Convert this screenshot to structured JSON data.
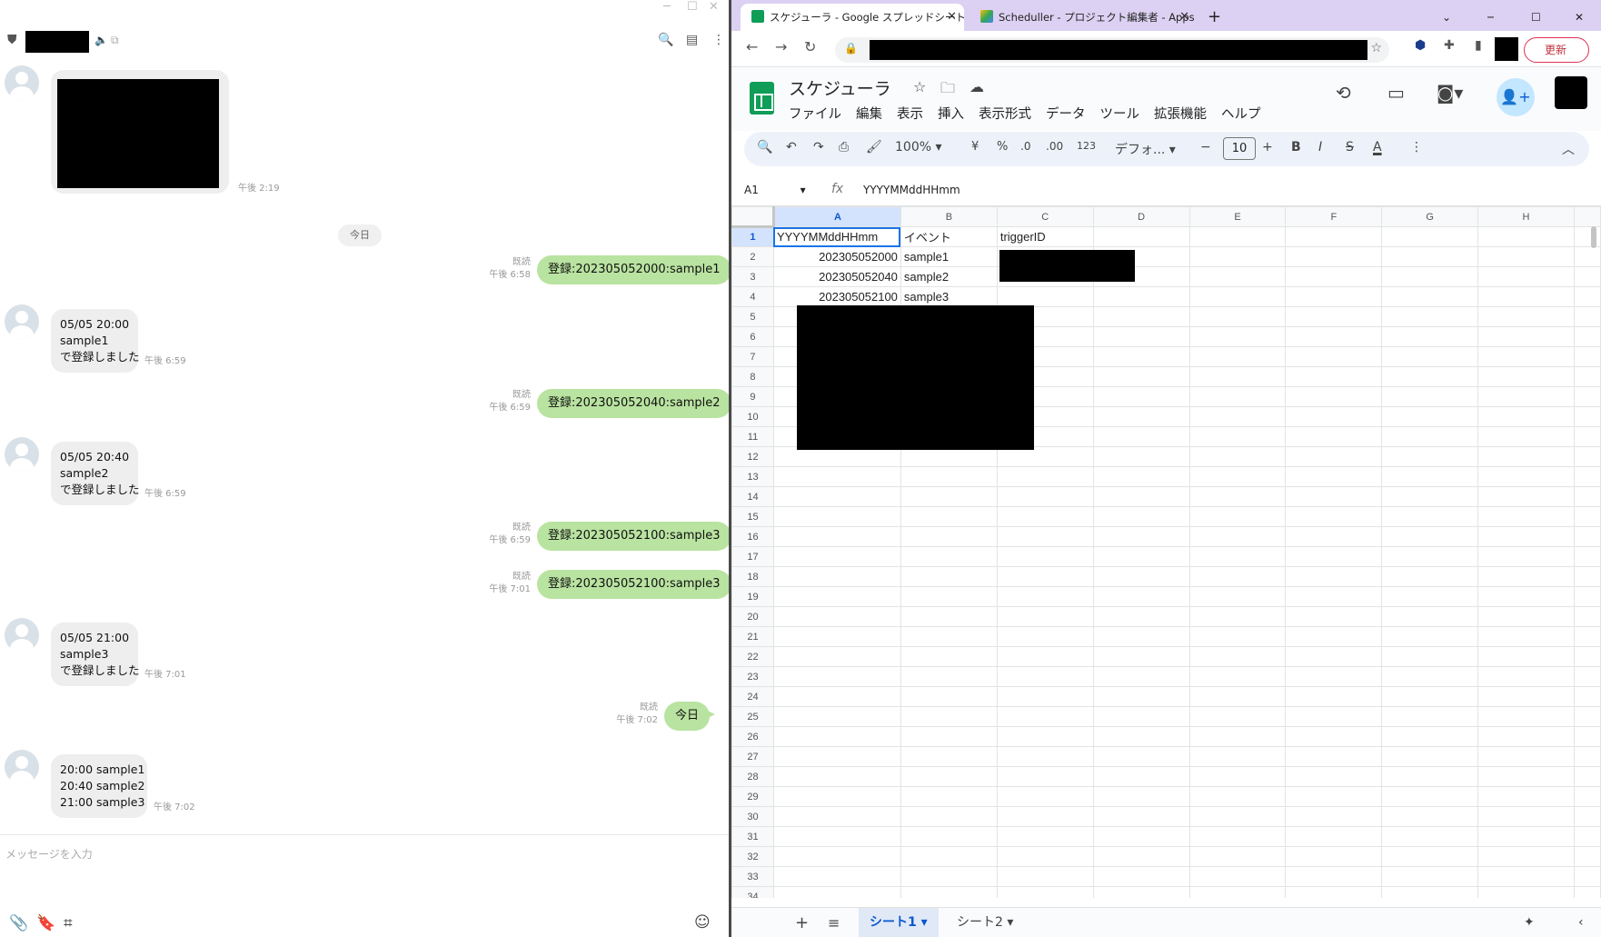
{
  "chat": {
    "input_placeholder": "メッセージを入力",
    "day_separator": "今日",
    "first_msg_time": "午後 2:19",
    "messages": [
      {
        "dir": "out",
        "text": "登録:202305052000:sample1",
        "read": "既読",
        "time": "午後 6:58"
      },
      {
        "dir": "in",
        "lines": [
          "05/05 20:00",
          "sample1",
          "で登録しました"
        ],
        "time": "午後 6:59"
      },
      {
        "dir": "out",
        "text": "登録:202305052040:sample2",
        "read": "既読",
        "time": "午後 6:59"
      },
      {
        "dir": "in",
        "lines": [
          "05/05 20:40",
          "sample2",
          "で登録しました"
        ],
        "time": "午後 6:59"
      },
      {
        "dir": "out",
        "text": "登録:202305052100:sample3",
        "read": "既読",
        "time": "午後 6:59"
      },
      {
        "dir": "out",
        "text": "登録:202305052100:sample3",
        "read": "既読",
        "time": "午後 7:01"
      },
      {
        "dir": "in",
        "lines": [
          "05/05 21:00",
          "sample3",
          "で登録しました"
        ],
        "time": "午後 7:01"
      },
      {
        "dir": "out",
        "text": "今日",
        "read": "既読",
        "time": "午後 7:02"
      },
      {
        "dir": "in",
        "lines": [
          "20:00 sample1",
          "20:40 sample2",
          "21:00 sample3"
        ],
        "time": "午後 7:02"
      }
    ]
  },
  "browser": {
    "tabs": [
      {
        "title": "スケジューラ - Google スプレッドシート",
        "active": true
      },
      {
        "title": "Scheduller - プロジェクト編集者 - Apps",
        "active": false
      }
    ],
    "update_label": "更新"
  },
  "sheets": {
    "doc_title": "スケジューラ",
    "menu": [
      "ファイル",
      "編集",
      "表示",
      "挿入",
      "表示形式",
      "データ",
      "ツール",
      "拡張機能",
      "ヘルプ"
    ],
    "toolbar": {
      "zoom": "100%",
      "currency": "¥",
      "percent": "%",
      "dec_less": ".0",
      "dec_more": ".00",
      "number_fmt": "123",
      "font": "デフォ...",
      "font_size": "10"
    },
    "name_box": "A1",
    "formula": "YYYYMMddHHmm",
    "columns": [
      "A",
      "B",
      "C",
      "D",
      "E",
      "F",
      "G",
      "H"
    ],
    "rows": [
      [
        "YYYYMMddHHmm",
        "イベント",
        "triggerID"
      ],
      [
        "202305052000",
        "sample1",
        ""
      ],
      [
        "202305052040",
        "sample2",
        ""
      ],
      [
        "202305052100",
        "sample3",
        ""
      ]
    ],
    "row_count": 34,
    "sheet_tabs": [
      "シート1",
      "シート2"
    ],
    "colors": {
      "accent": "#0b57d0",
      "green": "#0f9d58"
    }
  }
}
